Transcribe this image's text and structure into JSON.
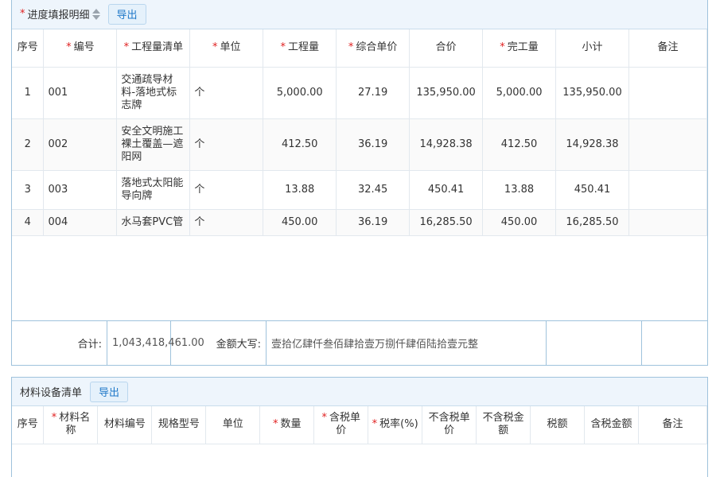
{
  "progress": {
    "title": "进度填报明细",
    "export_label": "导出",
    "columns": [
      {
        "label": "序号",
        "required": false
      },
      {
        "label": "编号",
        "required": true
      },
      {
        "label": "工程量清单",
        "required": true
      },
      {
        "label": "单位",
        "required": true
      },
      {
        "label": "工程量",
        "required": true
      },
      {
        "label": "综合单价",
        "required": true
      },
      {
        "label": "合价",
        "required": false
      },
      {
        "label": "完工量",
        "required": true
      },
      {
        "label": "小计",
        "required": false
      },
      {
        "label": "备注",
        "required": false
      }
    ],
    "rows": [
      {
        "seq": "1",
        "code": "001",
        "item": "交通疏导材料-落地式标志牌",
        "unit": "个",
        "qty": "5,000.00",
        "unit_price": "27.19",
        "amount": "135,950.00",
        "done_qty": "5,000.00",
        "subtotal": "135,950.00",
        "remark": ""
      },
      {
        "seq": "2",
        "code": "002",
        "item": "安全文明施工裸土覆盖—遮阳网",
        "unit": "个",
        "qty": "412.50",
        "unit_price": "36.19",
        "amount": "14,928.38",
        "done_qty": "412.50",
        "subtotal": "14,928.38",
        "remark": ""
      },
      {
        "seq": "3",
        "code": "003",
        "item": "落地式太阳能导向牌",
        "unit": "个",
        "qty": "13.88",
        "unit_price": "32.45",
        "amount": "450.41",
        "done_qty": "13.88",
        "subtotal": "450.41",
        "remark": ""
      },
      {
        "seq": "4",
        "code": "004",
        "item": "水马套PVC管",
        "unit": "个",
        "qty": "450.00",
        "unit_price": "36.19",
        "amount": "16,285.50",
        "done_qty": "450.00",
        "subtotal": "16,285.50",
        "remark": ""
      }
    ],
    "footer": {
      "total_label": "合计:",
      "total_value": "1,043,418,461.00",
      "words_label": "金额大写:",
      "words_value": "壹拾亿肆仟叁佰肆拾壹万捌仟肆佰陆拾壹元整"
    }
  },
  "materials": {
    "title": "材料设备清单",
    "export_label": "导出",
    "columns": [
      {
        "label": "序号",
        "required": false
      },
      {
        "label": "材料名称",
        "required": true
      },
      {
        "label": "材料编号",
        "required": false
      },
      {
        "label": "规格型号",
        "required": false
      },
      {
        "label": "单位",
        "required": false
      },
      {
        "label": "数量",
        "required": true
      },
      {
        "label": "含税单价",
        "required": true
      },
      {
        "label": "税率(%)",
        "required": true
      },
      {
        "label": "不含税单价",
        "required": false
      },
      {
        "label": "不含税金额",
        "required": false
      },
      {
        "label": "税额",
        "required": false
      },
      {
        "label": "含税金额",
        "required": false
      },
      {
        "label": "备注",
        "required": false
      }
    ]
  },
  "icons": {
    "required_marker": "*",
    "sort_icon": "sort-icon"
  },
  "colors": {
    "accent": "#1e78c8",
    "required": "#e02020",
    "header_bg": "#eef5fc",
    "border": "#9fc2dc"
  }
}
